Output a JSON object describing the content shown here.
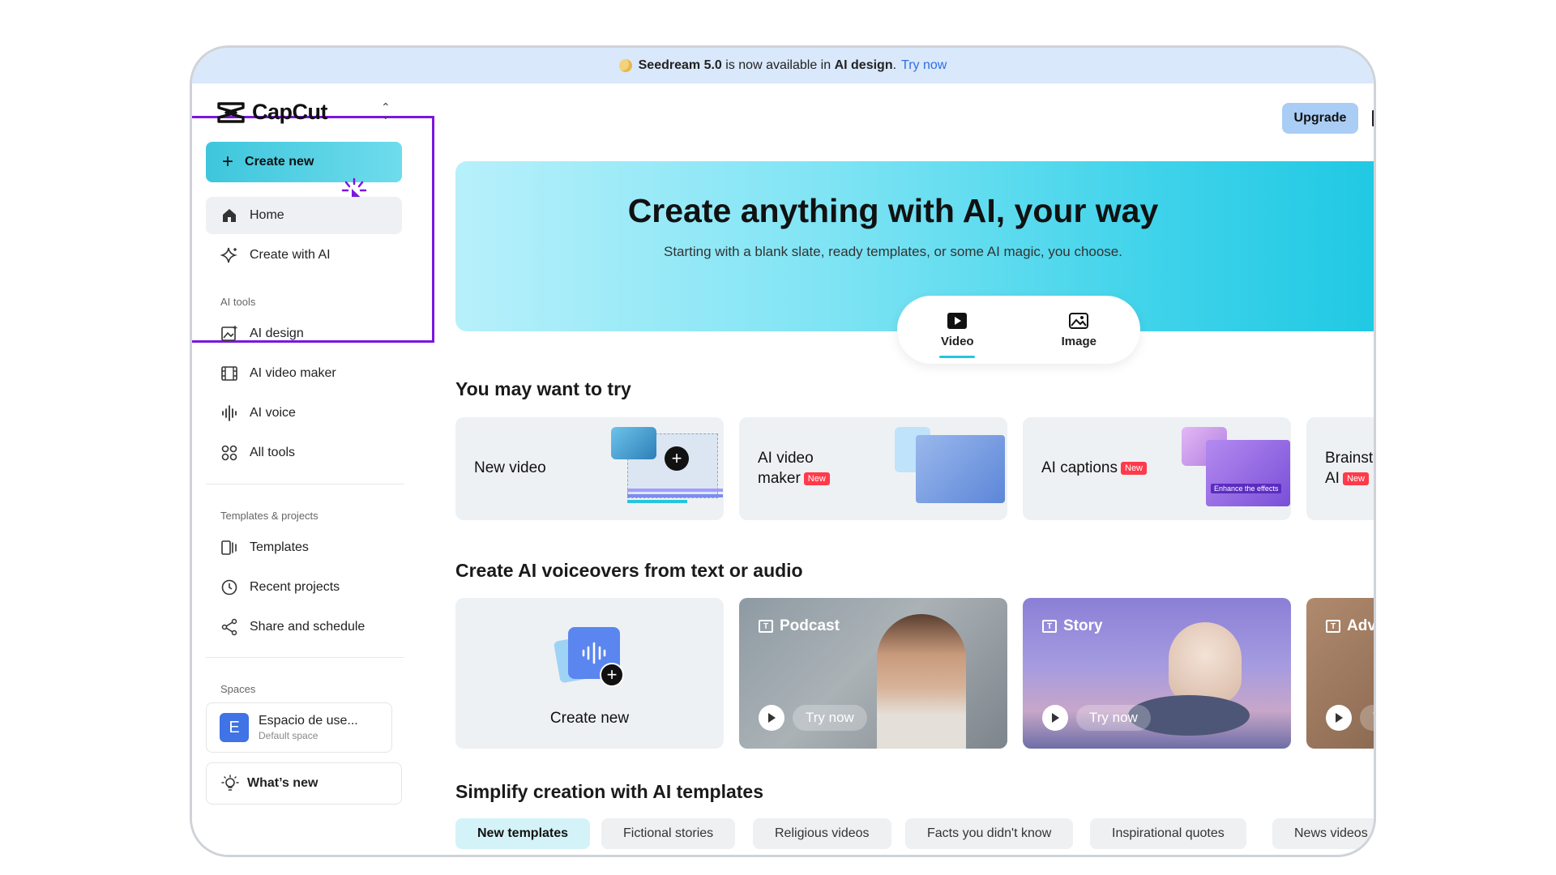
{
  "banner": {
    "product": "Seedream 5.0",
    "text": "is now available in",
    "feature": "AI design",
    "link": "Try now"
  },
  "brand": {
    "name": "CapCut"
  },
  "sidebar": {
    "create_label": "Create new",
    "primary": [
      {
        "label": "Home",
        "icon": "home-icon",
        "active": true
      },
      {
        "label": "Create with AI",
        "icon": "sparkle-icon"
      }
    ],
    "ai_tools_label": "AI tools",
    "ai_tools": [
      {
        "label": "AI design",
        "icon": "image-edit-icon"
      },
      {
        "label": "AI video maker",
        "icon": "film-icon"
      },
      {
        "label": "AI voice",
        "icon": "waveform-icon"
      },
      {
        "label": "All tools",
        "icon": "grid-icon"
      }
    ],
    "templates_label": "Templates & projects",
    "templates": [
      {
        "label": "Templates",
        "icon": "templates-icon"
      },
      {
        "label": "Recent projects",
        "icon": "clock-icon"
      },
      {
        "label": "Share and schedule",
        "icon": "share-icon"
      }
    ],
    "spaces_label": "Spaces",
    "space": {
      "initial": "E",
      "name": "Espacio de use...",
      "sub": "Default space"
    },
    "whats_new": "What’s new"
  },
  "header": {
    "upgrade": "Upgrade"
  },
  "hero": {
    "title": "Create anything with AI, your way",
    "subtitle": "Starting with a blank slate, ready templates, or some AI magic, you choose.",
    "modes": [
      {
        "label": "Video",
        "active": true
      },
      {
        "label": "Image"
      }
    ]
  },
  "try_section": {
    "title": "You may want to try",
    "cards": [
      {
        "line1": "New video",
        "line2": "",
        "new": false
      },
      {
        "line1": "AI video",
        "line2": "maker",
        "new": true
      },
      {
        "line1": "AI captions",
        "line2": "",
        "new": true
      },
      {
        "line1": "Brainsto",
        "line2": "AI",
        "new": true
      }
    ],
    "new_badge": "New",
    "caption_chip": "Enhance the effects"
  },
  "voice_section": {
    "title": "Create AI voiceovers from text or audio",
    "create_label": "Create new",
    "cards": [
      {
        "tag": "Podcast",
        "try": "Try now"
      },
      {
        "tag": "Story",
        "try": "Try now"
      },
      {
        "tag": "Adve",
        "try": "Tr"
      }
    ]
  },
  "templates_section": {
    "title": "Simplify creation with AI templates",
    "tabs": [
      {
        "label": "New templates",
        "active": true
      },
      {
        "label": "Fictional stories"
      },
      {
        "label": "Religious videos"
      },
      {
        "label": "Facts you didn't know"
      },
      {
        "label": "Inspirational quotes"
      },
      {
        "label": "News videos"
      }
    ]
  },
  "colors": {
    "accent": "#3ec6dc",
    "highlight_border": "#7b16e0",
    "new_badge": "#ff3a4a",
    "upgrade_bg": "#a9cdf5"
  }
}
